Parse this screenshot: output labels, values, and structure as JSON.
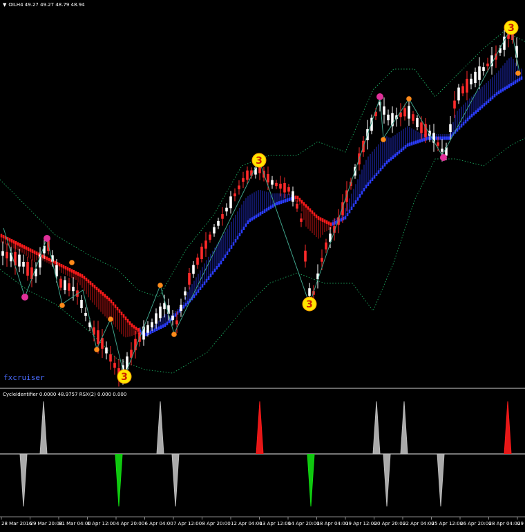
{
  "header": {
    "arrow_icon": "triangle-down-icon",
    "symbol_line": "OILH4 49.27 49.27 48.79 48.94"
  },
  "indicator": {
    "header_line": "CycleIdentifier 0.0000 48.9757 RSX(2) 0.000 0.000"
  },
  "watermark": "fxcruiser",
  "time_axis": {
    "labels": [
      "28 Mar 2016",
      "29 Mar 20:00",
      "31 Mar 04:00",
      "1 Apr 12:00",
      "4 Apr 20:00",
      "6 Apr 04:00",
      "7 Apr 12:00",
      "8 Apr 20:00",
      "12 Apr 04:00",
      "13 Apr 12:00",
      "14 Apr 20:00",
      "18 Apr 04:00",
      "19 Apr 12:00",
      "20 Apr 20:00",
      "22 Apr 04:00",
      "25 Apr 12:00",
      "26 Apr 20:00",
      "28 Apr 04:00",
      "29 Apr"
    ]
  },
  "markers": {
    "wave_labels": [
      "3",
      "3",
      "3",
      "3"
    ]
  },
  "colors": {
    "background": "#000000",
    "bull_candle": "#ffffff",
    "bear_candle": "#ff2a2a",
    "ma_down": "#ff1a1a",
    "ma_up": "#2a3cff",
    "envelope": "#1aa05a",
    "zigzag": "#3fa28a",
    "wave_label_fill": "#ffe600",
    "peak_marker": "#e0309a",
    "swing_marker": "#ff8a1a",
    "cycle_high": "#ff1a1a",
    "cycle_low": "#11dd11",
    "cycle_line": "#bdbdbd"
  }
}
